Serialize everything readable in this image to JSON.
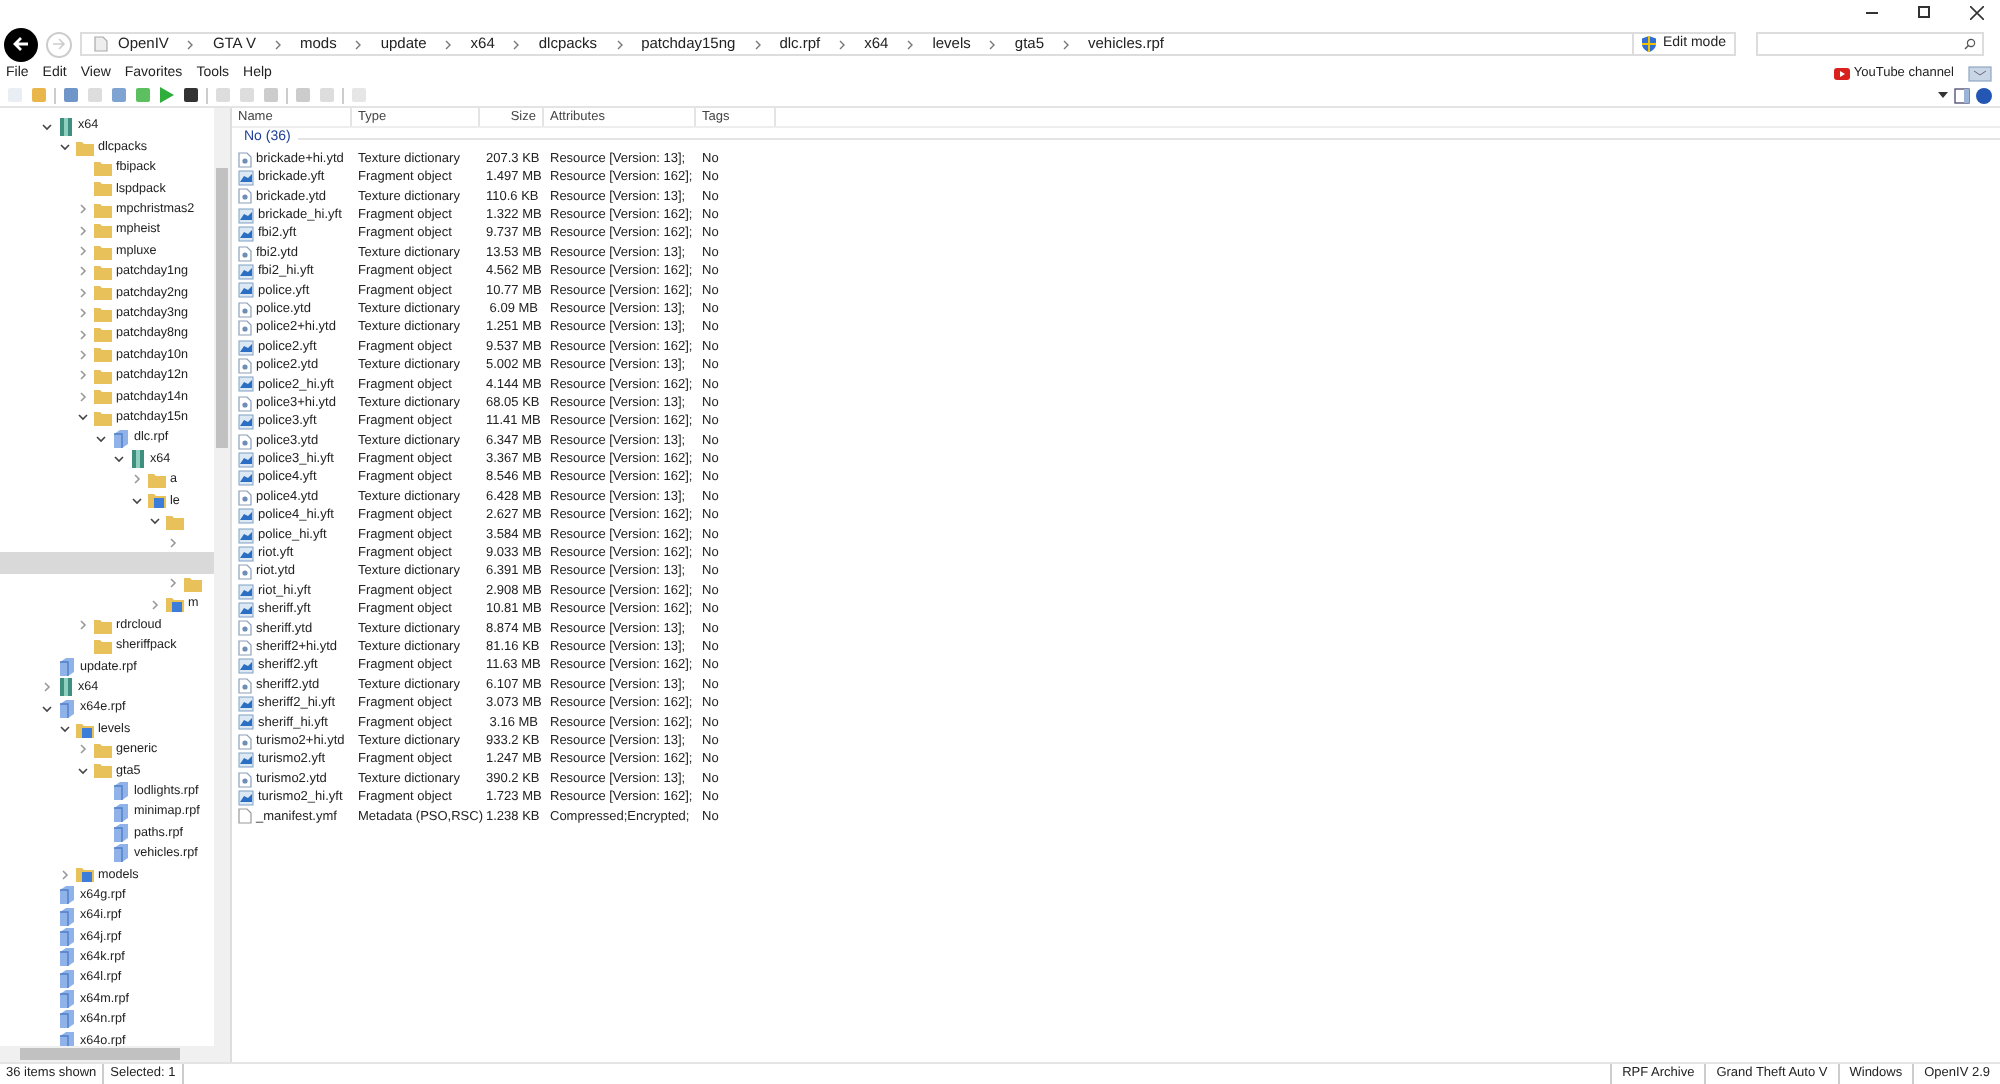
{
  "address_bar": {
    "crumbs": [
      "OpenIV",
      "GTA V",
      "mods",
      "update",
      "x64",
      "dlcpacks",
      "patchday15ng",
      "dlc.rpf",
      "x64",
      "levels",
      "gta5",
      "vehicles.rpf"
    ]
  },
  "edit_mode_button": "Edit mode",
  "menu": [
    "File",
    "Edit",
    "View",
    "Favorites",
    "Tools",
    "Help"
  ],
  "youtube_link": "YouTube channel",
  "tree": [
    {
      "label": "x64",
      "kind": "archive",
      "expanded": true,
      "selected": false,
      "children": [
        {
          "label": "dlcpacks",
          "kind": "folder",
          "expanded": true,
          "selected": false,
          "children": [
            {
              "label": "fbipack",
              "kind": "folder",
              "selected": false
            },
            {
              "label": "lspdpack",
              "kind": "folder",
              "selected": false
            },
            {
              "label": "mpchristmas2",
              "kind": "folder",
              "expanded": false,
              "selected": false
            },
            {
              "label": "mpheist",
              "kind": "folder",
              "expanded": false,
              "selected": false
            },
            {
              "label": "mpluxe",
              "kind": "folder",
              "expanded": false,
              "selected": false
            },
            {
              "label": "patchday1ng",
              "kind": "folder",
              "expanded": false,
              "selected": false
            },
            {
              "label": "patchday2ng",
              "kind": "folder",
              "expanded": false,
              "selected": false
            },
            {
              "label": "patchday3ng",
              "kind": "folder",
              "expanded": false,
              "selected": false
            },
            {
              "label": "patchday8ng",
              "kind": "folder",
              "expanded": false,
              "selected": false
            },
            {
              "label": "patchday10n",
              "kind": "folder",
              "expanded": false,
              "selected": false
            },
            {
              "label": "patchday12n",
              "kind": "folder",
              "expanded": false,
              "selected": false
            },
            {
              "label": "patchday14n",
              "kind": "folder",
              "expanded": false,
              "selected": false
            },
            {
              "label": "patchday15n",
              "kind": "folder",
              "expanded": true,
              "selected": false,
              "children": [
                {
                  "label": "dlc.rpf",
                  "kind": "rpf",
                  "expanded": true,
                  "selected": false,
                  "children": [
                    {
                      "label": "x64",
                      "kind": "archive",
                      "expanded": true,
                      "selected": false,
                      "children": [
                        {
                          "label": "a",
                          "kind": "folder",
                          "expanded": false,
                          "selected": false
                        },
                        {
                          "label": "le",
                          "kind": "levels",
                          "expanded": true,
                          "selected": false,
                          "children": [
                            {
                              "kind": "folder",
                              "expanded": true,
                              "selected": false,
                              "children": [
                                {
                                  "kind": "none",
                                  "expanded": false,
                                  "selected": false
                                },
                                {
                                  "kind": "none",
                                  "selected": true
                                },
                                {
                                  "kind": "folder",
                                  "expanded": false,
                                  "selected": false
                                }
                              ]
                            },
                            {
                              "label": "m",
                              "kind": "levels",
                              "expanded": false,
                              "selected": false
                            }
                          ]
                        }
                      ]
                    }
                  ]
                }
              ]
            },
            {
              "label": "rdrcloud",
              "kind": "folder",
              "expanded": false,
              "selected": false
            },
            {
              "label": "sheriffpack",
              "kind": "folder",
              "selected": false
            }
          ]
        }
      ]
    },
    {
      "label": "update.rpf",
      "kind": "rpf",
      "selected": false
    },
    {
      "label": "x64",
      "kind": "archive",
      "expanded": false,
      "selected": false
    },
    {
      "label": "x64e.rpf",
      "kind": "rpf",
      "expanded": true,
      "selected": false,
      "children": [
        {
          "label": "levels",
          "kind": "levels",
          "expanded": true,
          "selected": false,
          "children": [
            {
              "label": "generic",
              "kind": "folder",
              "expanded": false,
              "selected": false
            },
            {
              "label": "gta5",
              "kind": "folder",
              "expanded": true,
              "selected": false,
              "children": [
                {
                  "label": "lodlights.rpf",
                  "kind": "rpf",
                  "selected": false
                },
                {
                  "label": "minimap.rpf",
                  "kind": "rpf",
                  "selected": false
                },
                {
                  "label": "paths.rpf",
                  "kind": "rpf",
                  "selected": false
                },
                {
                  "label": "vehicles.rpf",
                  "kind": "rpf",
                  "selected": false
                }
              ]
            }
          ]
        },
        {
          "label": "models",
          "kind": "levels",
          "expanded": false,
          "selected": false
        }
      ]
    },
    {
      "label": "x64g.rpf",
      "kind": "rpf",
      "selected": false
    },
    {
      "label": "x64i.rpf",
      "kind": "rpf",
      "selected": false
    },
    {
      "label": "x64j.rpf",
      "kind": "rpf",
      "selected": false
    },
    {
      "label": "x64k.rpf",
      "kind": "rpf",
      "selected": false
    },
    {
      "label": "x64l.rpf",
      "kind": "rpf",
      "selected": false
    },
    {
      "label": "x64m.rpf",
      "kind": "rpf",
      "selected": false
    },
    {
      "label": "x64n.rpf",
      "kind": "rpf",
      "selected": false
    },
    {
      "label": "x64o.rpf",
      "kind": "rpf",
      "selected": false
    }
  ],
  "table": {
    "columns": [
      "Name",
      "Type",
      "Size",
      "Attributes",
      "Tags"
    ],
    "group": "No (36)",
    "rows": [
      {
        "kind": "texture",
        "name": "brickade+hi.ytd",
        "type": "Texture dictionary",
        "size": "207.3 KB",
        "attributes": "Resource [Version: 13];",
        "tags": "No"
      },
      {
        "kind": "fragment",
        "name": "brickade.yft",
        "type": "Fragment object",
        "size": "1.497 MB",
        "attributes": "Resource [Version: 162];",
        "tags": "No"
      },
      {
        "kind": "texture",
        "name": "brickade.ytd",
        "type": "Texture dictionary",
        "size": "110.6 KB",
        "attributes": "Resource [Version: 13];",
        "tags": "No"
      },
      {
        "kind": "fragment",
        "name": "brickade_hi.yft",
        "type": "Fragment object",
        "size": "1.322 MB",
        "attributes": "Resource [Version: 162];",
        "tags": "No"
      },
      {
        "kind": "fragment",
        "name": "fbi2.yft",
        "type": "Fragment object",
        "size": "9.737 MB",
        "attributes": "Resource [Version: 162];",
        "tags": "No"
      },
      {
        "kind": "texture",
        "name": "fbi2.ytd",
        "type": "Texture dictionary",
        "size": "13.53 MB",
        "attributes": "Resource [Version: 13];",
        "tags": "No"
      },
      {
        "kind": "fragment",
        "name": "fbi2_hi.yft",
        "type": "Fragment object",
        "size": "4.562 MB",
        "attributes": "Resource [Version: 162];",
        "tags": "No"
      },
      {
        "kind": "fragment",
        "name": "police.yft",
        "type": "Fragment object",
        "size": "10.77 MB",
        "attributes": "Resource [Version: 162];",
        "tags": "No"
      },
      {
        "kind": "texture",
        "name": "police.ytd",
        "type": "Texture dictionary",
        "size": "6.09 MB",
        "attributes": "Resource [Version: 13];",
        "tags": "No"
      },
      {
        "kind": "texture",
        "name": "police2+hi.ytd",
        "type": "Texture dictionary",
        "size": "1.251 MB",
        "attributes": "Resource [Version: 13];",
        "tags": "No"
      },
      {
        "kind": "fragment",
        "name": "police2.yft",
        "type": "Fragment object",
        "size": "9.537 MB",
        "attributes": "Resource [Version: 162];",
        "tags": "No"
      },
      {
        "kind": "texture",
        "name": "police2.ytd",
        "type": "Texture dictionary",
        "size": "5.002 MB",
        "attributes": "Resource [Version: 13];",
        "tags": "No"
      },
      {
        "kind": "fragment",
        "name": "police2_hi.yft",
        "type": "Fragment object",
        "size": "4.144 MB",
        "attributes": "Resource [Version: 162];",
        "tags": "No"
      },
      {
        "kind": "texture",
        "name": "police3+hi.ytd",
        "type": "Texture dictionary",
        "size": "68.05 KB",
        "attributes": "Resource [Version: 13];",
        "tags": "No"
      },
      {
        "kind": "fragment",
        "name": "police3.yft",
        "type": "Fragment object",
        "size": "11.41 MB",
        "attributes": "Resource [Version: 162];",
        "tags": "No"
      },
      {
        "kind": "texture",
        "name": "police3.ytd",
        "type": "Texture dictionary",
        "size": "6.347 MB",
        "attributes": "Resource [Version: 13];",
        "tags": "No"
      },
      {
        "kind": "fragment",
        "name": "police3_hi.yft",
        "type": "Fragment object",
        "size": "3.367 MB",
        "attributes": "Resource [Version: 162];",
        "tags": "No"
      },
      {
        "kind": "fragment",
        "name": "police4.yft",
        "type": "Fragment object",
        "size": "8.546 MB",
        "attributes": "Resource [Version: 162];",
        "tags": "No"
      },
      {
        "kind": "texture",
        "name": "police4.ytd",
        "type": "Texture dictionary",
        "size": "6.428 MB",
        "attributes": "Resource [Version: 13];",
        "tags": "No"
      },
      {
        "kind": "fragment",
        "name": "police4_hi.yft",
        "type": "Fragment object",
        "size": "2.627 MB",
        "attributes": "Resource [Version: 162];",
        "tags": "No"
      },
      {
        "kind": "fragment",
        "name": "police_hi.yft",
        "type": "Fragment object",
        "size": "3.584 MB",
        "attributes": "Resource [Version: 162];",
        "tags": "No"
      },
      {
        "kind": "fragment",
        "name": "riot.yft",
        "type": "Fragment object",
        "size": "9.033 MB",
        "attributes": "Resource [Version: 162];",
        "tags": "No"
      },
      {
        "kind": "texture",
        "name": "riot.ytd",
        "type": "Texture dictionary",
        "size": "6.391 MB",
        "attributes": "Resource [Version: 13];",
        "tags": "No"
      },
      {
        "kind": "fragment",
        "name": "riot_hi.yft",
        "type": "Fragment object",
        "size": "2.908 MB",
        "attributes": "Resource [Version: 162];",
        "tags": "No"
      },
      {
        "kind": "fragment",
        "name": "sheriff.yft",
        "type": "Fragment object",
        "size": "10.81 MB",
        "attributes": "Resource [Version: 162];",
        "tags": "No"
      },
      {
        "kind": "texture",
        "name": "sheriff.ytd",
        "type": "Texture dictionary",
        "size": "8.874 MB",
        "attributes": "Resource [Version: 13];",
        "tags": "No"
      },
      {
        "kind": "texture",
        "name": "sheriff2+hi.ytd",
        "type": "Texture dictionary",
        "size": "81.16 KB",
        "attributes": "Resource [Version: 13];",
        "tags": "No"
      },
      {
        "kind": "fragment",
        "name": "sheriff2.yft",
        "type": "Fragment object",
        "size": "11.63 MB",
        "attributes": "Resource [Version: 162];",
        "tags": "No"
      },
      {
        "kind": "texture",
        "name": "sheriff2.ytd",
        "type": "Texture dictionary",
        "size": "6.107 MB",
        "attributes": "Resource [Version: 13];",
        "tags": "No"
      },
      {
        "kind": "fragment",
        "name": "sheriff2_hi.yft",
        "type": "Fragment object",
        "size": "3.073 MB",
        "attributes": "Resource [Version: 162];",
        "tags": "No"
      },
      {
        "kind": "fragment",
        "name": "sheriff_hi.yft",
        "type": "Fragment object",
        "size": "3.16 MB",
        "attributes": "Resource [Version: 162];",
        "tags": "No"
      },
      {
        "kind": "texture",
        "name": "turismo2+hi.ytd",
        "type": "Texture dictionary",
        "size": "933.2 KB",
        "attributes": "Resource [Version: 13];",
        "tags": "No"
      },
      {
        "kind": "fragment",
        "name": "turismo2.yft",
        "type": "Fragment object",
        "size": "1.247 MB",
        "attributes": "Resource [Version: 162];",
        "tags": "No"
      },
      {
        "kind": "texture",
        "name": "turismo2.ytd",
        "type": "Texture dictionary",
        "size": "390.2 KB",
        "attributes": "Resource [Version: 13];",
        "tags": "No"
      },
      {
        "kind": "fragment",
        "name": "turismo2_hi.yft",
        "type": "Fragment object",
        "size": "1.723 MB",
        "attributes": "Resource [Version: 162];",
        "tags": "No"
      },
      {
        "kind": "metadata",
        "name": "_manifest.ymf",
        "type": "Metadata (PSO,RSC)",
        "size": "1.238 KB",
        "attributes": "Compressed;Encrypted;",
        "tags": "No"
      }
    ]
  },
  "status_bar": {
    "left": [
      "36 items shown",
      "Selected: 1"
    ],
    "right": [
      "RPF Archive",
      "Grand Theft Auto V",
      "Windows",
      "OpenIV 2.9"
    ]
  }
}
